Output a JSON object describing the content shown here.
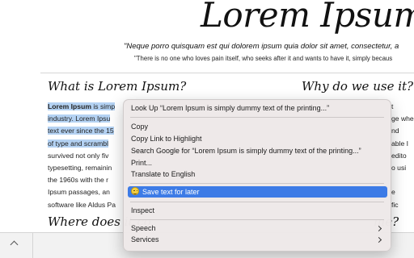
{
  "page": {
    "title": "Lorem Ipsum",
    "quote1": "\"Neque porro quisquam est qui dolorem ipsum quia dolor sit amet, consectetur, a",
    "quote2": "\"There is no one who loves pain itself, who seeks after it and wants to have it, simply becaus",
    "heading_left": "What is Lorem Ipsum?",
    "heading_right": "Why do we use it?",
    "heading_left2": "Where does it co",
    "heading_right2": "me?",
    "paragraph_lines": [
      {
        "strong": "Lorem Ipsum",
        "rest": " is simp"
      },
      {
        "text": "industry. Lorem Ipsu"
      },
      {
        "text": "text ever since the 15"
      },
      {
        "text": "of type and scrambl"
      },
      {
        "text": "survived not only fiv"
      },
      {
        "text": "typesetting, remainin"
      },
      {
        "text": "the 1960s with the r"
      },
      {
        "text": "Ipsum passages, an"
      },
      {
        "text": "software like Aldus Pa"
      }
    ],
    "right_fragments": [
      "t",
      "ge whe",
      "nd",
      "able I",
      "edito",
      "o usi",
      "",
      "e",
      "fic"
    ]
  },
  "context_menu": {
    "look_up": "Look Up “Lorem Ipsum is simply dummy text of the printing...”",
    "copy": "Copy",
    "copy_link": "Copy Link to Highlight",
    "search_google": "Search Google for “Lorem Ipsum is simply dummy text of the printing...”",
    "print": "Print...",
    "translate": "Translate to English",
    "save_text": "Save text for later",
    "inspect": "Inspect",
    "speech": "Speech",
    "services": "Services"
  },
  "colors": {
    "selection_highlight": "#b4d2f3",
    "menu_highlight": "#3d7be6",
    "menu_bg": "#eee9e9"
  }
}
